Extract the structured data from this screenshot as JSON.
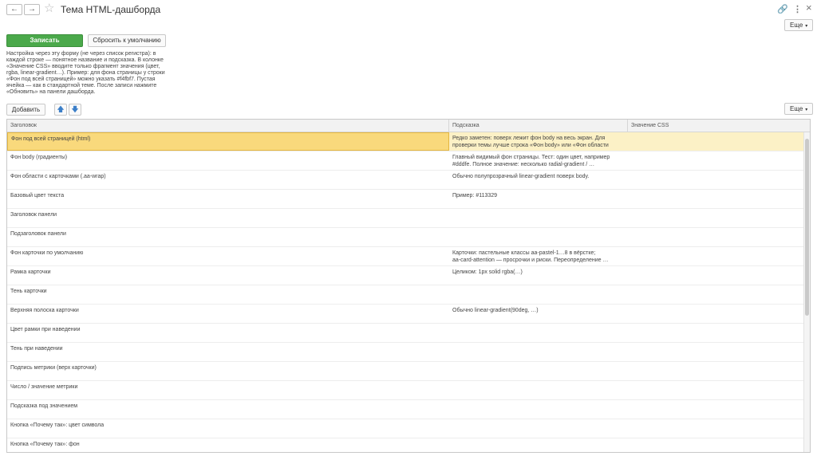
{
  "window": {
    "title": "Тема HTML-дашборда",
    "back_glyph": "←",
    "forward_glyph": "→",
    "star_glyph": "☆",
    "link_glyph": "🔗",
    "menu_glyph": "⋮",
    "close_glyph": "×",
    "more_label": "Еще",
    "caret_glyph": "▾"
  },
  "toolbar": {
    "save_label": "Записать",
    "reset_label": "Сбросить к умолчанию"
  },
  "help_lines": [
    "Настройка через эту форму (не через список регистра): в",
    "каждой строке — понятное название и подсказка. В колонке",
    "«Значение CSS» вводите только фрагмент значения (цвет,",
    "rgba, linear-gradient…). Пример: для фона страницы у строки",
    "«Фон под всей страницей» можно указать #f4fbf7. Пустая",
    "ячейка — как в стандартной теме. После записи нажмите",
    "«Обновить» на панели дашборда."
  ],
  "table_toolbar": {
    "add_label": "Добавить",
    "up_glyph": "🡅",
    "down_glyph": "🡇",
    "more_label": "Еще"
  },
  "table": {
    "headers": [
      "Заголовок",
      "Подсказка",
      "Значение CSS"
    ],
    "rows": [
      {
        "title": "Фон под всей страницей (html)",
        "hint1": "Редко заметен: поверх лежит фон body на весь экран. Для",
        "hint2": "проверки темы лучше строка «Фон body» или «Фон области",
        "value": ""
      },
      {
        "title": "Фон body (градиенты)",
        "hint1": "Главный видимый фон страницы. Тест: один цвет, например",
        "hint2": "#dddfe. Полное значение: несколько radial-gradient / …",
        "value": ""
      },
      {
        "title": "Фон области с карточками (.aa-wrap)",
        "hint1": "Обычно полупрозрачный linear-gradient поверх body.",
        "hint2": "",
        "value": ""
      },
      {
        "title": "Базовый цвет текста",
        "hint1": "Пример: #113329",
        "hint2": "",
        "value": ""
      },
      {
        "title": "Заголовок панели",
        "hint1": "",
        "hint2": "",
        "value": ""
      },
      {
        "title": "Подзаголовок панели",
        "hint1": "",
        "hint2": "",
        "value": ""
      },
      {
        "title": "Фон карточки по умолчанию",
        "hint1": "Карточки: пастельные классы aa-pastel-1…8 в вёрстке;",
        "hint2": "aa-card-attention — просрочки и риски. Переопределение …",
        "value": ""
      },
      {
        "title": "Рамка карточки",
        "hint1": "Целиком: 1px solid rgba(…)",
        "hint2": "",
        "value": ""
      },
      {
        "title": "Тень карточки",
        "hint1": "",
        "hint2": "",
        "value": ""
      },
      {
        "title": "Верхняя полоска карточки",
        "hint1": "Обычно linear-gradient(90deg, …)",
        "hint2": "",
        "value": ""
      },
      {
        "title": "Цвет рамки при наведении",
        "hint1": "",
        "hint2": "",
        "value": ""
      },
      {
        "title": "Тень при наведении",
        "hint1": "",
        "hint2": "",
        "value": ""
      },
      {
        "title": "Подпись метрики (верх карточки)",
        "hint1": "",
        "hint2": "",
        "value": ""
      },
      {
        "title": "Число / значение метрики",
        "hint1": "",
        "hint2": "",
        "value": ""
      },
      {
        "title": "Подсказка под значением",
        "hint1": "",
        "hint2": "",
        "value": ""
      },
      {
        "title": "Кнопка «Почему так»: цвет символа",
        "hint1": "",
        "hint2": "",
        "value": ""
      },
      {
        "title": "Кнопка «Почему так»: фон",
        "hint1": "",
        "hint2": "",
        "value": ""
      }
    ]
  }
}
